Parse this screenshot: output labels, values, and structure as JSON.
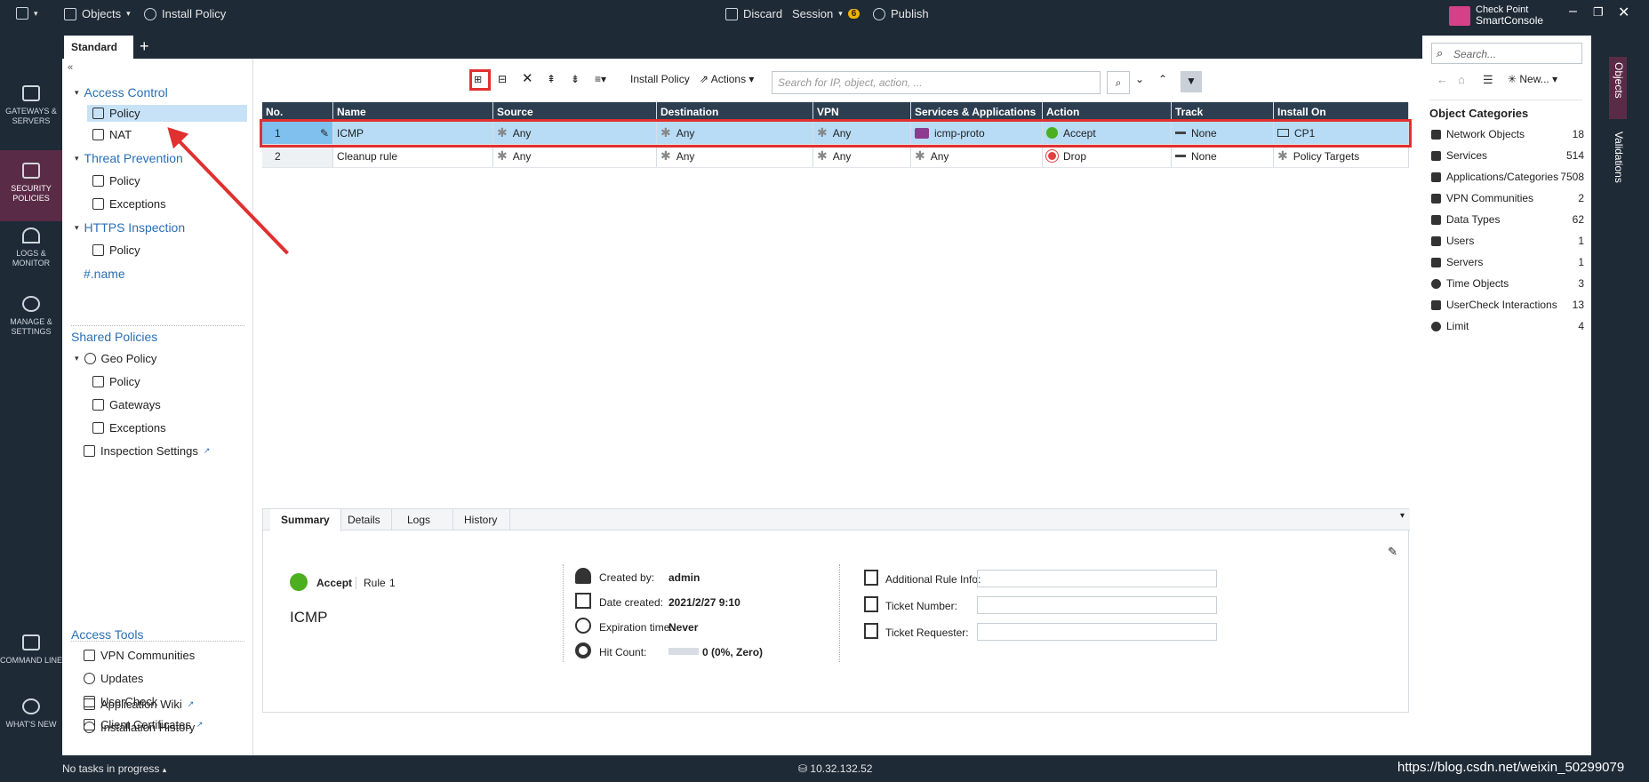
{
  "topbar": {
    "menu_label": "",
    "objects_label": "Objects",
    "install_policy_label": "Install Policy",
    "discard_label": "Discard",
    "session_label": "Session",
    "session_count": "6",
    "publish_label": "Publish",
    "brand_line1": "Check Point",
    "brand_line2": "SmartConsole"
  },
  "left_rail": {
    "items": [
      {
        "label": "GATEWAYS & SERVERS"
      },
      {
        "label": "SECURITY POLICIES"
      },
      {
        "label": "LOGS & MONITOR"
      },
      {
        "label": "MANAGE & SETTINGS"
      },
      {
        "label": "COMMAND LINE"
      },
      {
        "label": "WHAT'S NEW"
      }
    ]
  },
  "tabs": {
    "active": "Standard",
    "add": "+"
  },
  "nav": {
    "access_control": "Access Control",
    "ac_policy": "Policy",
    "ac_nat": "NAT",
    "threat_prevention": "Threat Prevention",
    "tp_policy": "Policy",
    "tp_exceptions": "Exceptions",
    "https_inspection": "HTTPS Inspection",
    "https_policy": "Policy",
    "name_item": "#.name",
    "shared_policies": "Shared Policies",
    "geo_policy": "Geo Policy",
    "geo_policy_policy": "Policy",
    "geo_gateways": "Gateways",
    "geo_exceptions": "Exceptions",
    "inspection_settings": "Inspection Settings",
    "access_tools": "Access Tools",
    "vpn_communities": "VPN Communities",
    "updates": "Updates",
    "usercheck": "UserCheck",
    "client_certificates": "Client Certificates",
    "application_wiki": "Application Wiki",
    "installation_history": "Installation History"
  },
  "toolbar": {
    "install_policy": "Install Policy",
    "actions": "Actions",
    "search_placeholder": "Search for IP, object, action, ..."
  },
  "grid": {
    "headers": [
      "No.",
      "Name",
      "Source",
      "Destination",
      "VPN",
      "Services & Applications",
      "Action",
      "Track",
      "Install On"
    ],
    "rows": [
      {
        "no": "1",
        "name": "ICMP",
        "source": "Any",
        "destination": "Any",
        "vpn": "Any",
        "services": "icmp-proto",
        "action": "Accept",
        "track": "None",
        "install_on": "CP1"
      },
      {
        "no": "2",
        "name": "Cleanup rule",
        "source": "Any",
        "destination": "Any",
        "vpn": "Any",
        "services": "Any",
        "action": "Drop",
        "track": "None",
        "install_on": "Policy Targets"
      }
    ]
  },
  "details": {
    "tabs": [
      "Summary",
      "Details",
      "Logs",
      "History"
    ],
    "action": "Accept",
    "rule_label": "Rule",
    "rule_no": "1",
    "rule_name": "ICMP",
    "created_by_label": "Created by:",
    "created_by": "admin",
    "date_created_label": "Date created:",
    "date_created": "2021/2/27 9:10",
    "expiration_label": "Expiration time:",
    "expiration": "Never",
    "hit_count_label": "Hit Count:",
    "hit_count": "0 (0%, Zero)",
    "additional_info_label": "Additional Rule Info:",
    "ticket_number_label": "Ticket Number:",
    "ticket_requester_label": "Ticket Requester:"
  },
  "objects_panel": {
    "search_placeholder": "Search...",
    "new_label": "New...",
    "title": "Object Categories",
    "categories": [
      {
        "name": "Network Objects",
        "count": "18"
      },
      {
        "name": "Services",
        "count": "514"
      },
      {
        "name": "Applications/Categories",
        "count": "7508"
      },
      {
        "name": "VPN Communities",
        "count": "2"
      },
      {
        "name": "Data Types",
        "count": "62"
      },
      {
        "name": "Users",
        "count": "1"
      },
      {
        "name": "Servers",
        "count": "1"
      },
      {
        "name": "Time Objects",
        "count": "3"
      },
      {
        "name": "UserCheck Interactions",
        "count": "13"
      },
      {
        "name": "Limit",
        "count": "4"
      }
    ],
    "vertical_tabs": [
      "Objects",
      "Validations"
    ]
  },
  "statusbar": {
    "tasks": "No tasks in progress",
    "server_ip": "10.32.132.52",
    "watermark": "https://blog.csdn.net/weixin_50299079"
  },
  "colors": {
    "chrome": "#1e2a36",
    "accent": "#5a2b46",
    "highlight_box": "#e03030",
    "selected_row": "#b8dcf6",
    "link": "#2a6fb5"
  }
}
